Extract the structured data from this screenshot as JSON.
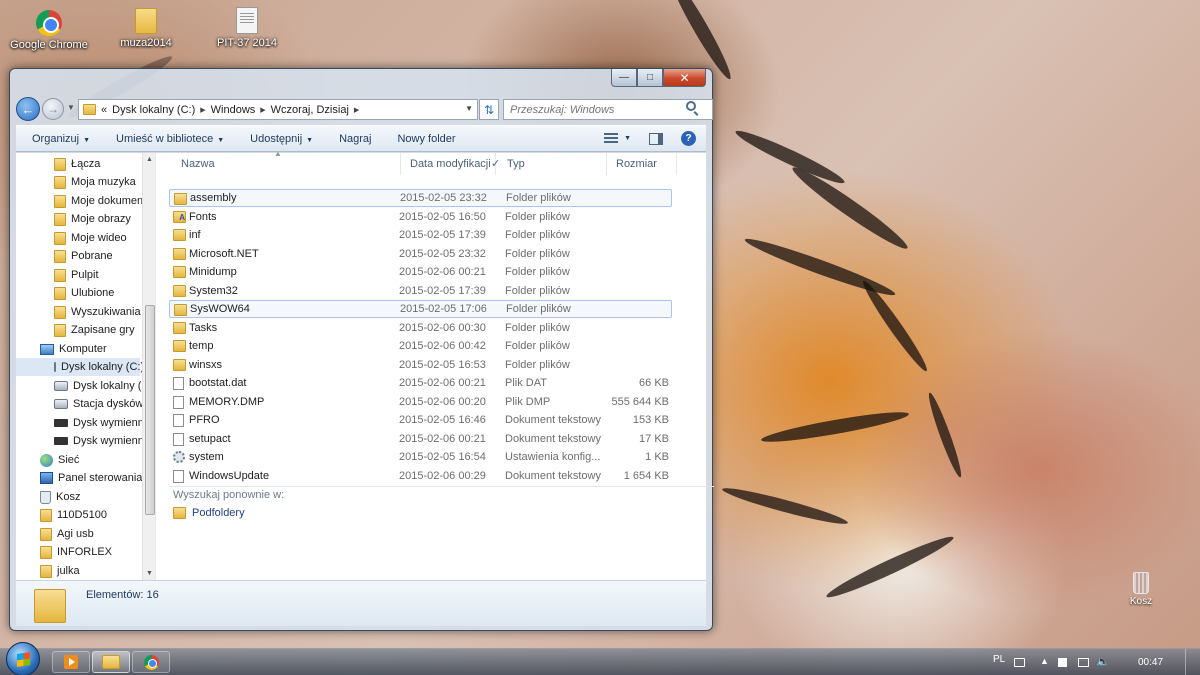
{
  "desktop": {
    "icons": [
      {
        "label": "Google Chrome",
        "icon": "chrome-icon"
      },
      {
        "label": "muza2014",
        "icon": "folder-icon"
      },
      {
        "label": "PIT-37 2014",
        "icon": "document-icon"
      }
    ],
    "recycle_bin": "Kosz"
  },
  "window": {
    "address": {
      "overflow": "«",
      "segments": [
        "Dysk lokalny (C:)",
        "Windows",
        "Wczoraj, Dzisiaj"
      ]
    },
    "search_placeholder": "Przeszukaj: Windows",
    "toolbar": {
      "organize": "Organizuj",
      "include_library": "Umieść w bibliotece",
      "share": "Udostępnij",
      "burn": "Nagraj",
      "new_folder": "Nowy folder"
    },
    "nav_pane": [
      {
        "label": "Łącza",
        "icon": "folder"
      },
      {
        "label": "Moja muzyka",
        "icon": "folder"
      },
      {
        "label": "Moje dokumenty",
        "icon": "folder"
      },
      {
        "label": "Moje obrazy",
        "icon": "folder"
      },
      {
        "label": "Moje wideo",
        "icon": "folder"
      },
      {
        "label": "Pobrane",
        "icon": "folder"
      },
      {
        "label": "Pulpit",
        "icon": "folder"
      },
      {
        "label": "Ulubione",
        "icon": "folder"
      },
      {
        "label": "Wyszukiwania",
        "icon": "folder"
      },
      {
        "label": "Zapisane gry",
        "icon": "folder"
      },
      {
        "label": "Komputer",
        "icon": "computer"
      },
      {
        "label": "Dysk lokalny (C:)",
        "icon": "drive"
      },
      {
        "label": "Dysk lokalny (D:)",
        "icon": "drive"
      },
      {
        "label": "Stacja dysków DVD",
        "icon": "drive"
      },
      {
        "label": "Dysk wymienny",
        "icon": "removable"
      },
      {
        "label": "Dysk wymienny",
        "icon": "removable"
      },
      {
        "label": "Sieć",
        "icon": "network"
      },
      {
        "label": "Panel sterowania",
        "icon": "panel"
      },
      {
        "label": "Kosz",
        "icon": "bin"
      },
      {
        "label": "110D5100",
        "icon": "folder"
      },
      {
        "label": "Agi usb",
        "icon": "folder"
      },
      {
        "label": "INFORLEX",
        "icon": "folder"
      },
      {
        "label": "julka",
        "icon": "folder"
      }
    ],
    "columns": {
      "name": "Nazwa",
      "date": "Data modyfikacji",
      "type": "Typ",
      "size": "Rozmiar"
    },
    "files": [
      {
        "name": "assembly",
        "date": "2015-02-05 23:32",
        "type": "Folder plików",
        "size": "",
        "icon": "folder"
      },
      {
        "name": "Fonts",
        "date": "2015-02-05 16:50",
        "type": "Folder plików",
        "size": "",
        "icon": "font"
      },
      {
        "name": "inf",
        "date": "2015-02-05 17:39",
        "type": "Folder plików",
        "size": "",
        "icon": "folder"
      },
      {
        "name": "Microsoft.NET",
        "date": "2015-02-05 23:32",
        "type": "Folder plików",
        "size": "",
        "icon": "folder"
      },
      {
        "name": "Minidump",
        "date": "2015-02-06 00:21",
        "type": "Folder plików",
        "size": "",
        "icon": "folder"
      },
      {
        "name": "System32",
        "date": "2015-02-05 17:39",
        "type": "Folder plików",
        "size": "",
        "icon": "folder"
      },
      {
        "name": "SysWOW64",
        "date": "2015-02-05 17:06",
        "type": "Folder plików",
        "size": "",
        "icon": "folder"
      },
      {
        "name": "Tasks",
        "date": "2015-02-06 00:30",
        "type": "Folder plików",
        "size": "",
        "icon": "folder"
      },
      {
        "name": "temp",
        "date": "2015-02-06 00:42",
        "type": "Folder plików",
        "size": "",
        "icon": "folder"
      },
      {
        "name": "winsxs",
        "date": "2015-02-05 16:53",
        "type": "Folder plików",
        "size": "",
        "icon": "folder"
      },
      {
        "name": "bootstat.dat",
        "date": "2015-02-06 00:21",
        "type": "Plik DAT",
        "size": "66 KB",
        "icon": "file"
      },
      {
        "name": "MEMORY.DMP",
        "date": "2015-02-06 00:20",
        "type": "Plik DMP",
        "size": "555 644 KB",
        "icon": "file"
      },
      {
        "name": "PFRO",
        "date": "2015-02-05 16:46",
        "type": "Dokument tekstowy",
        "size": "153 KB",
        "icon": "file"
      },
      {
        "name": "setupact",
        "date": "2015-02-06 00:21",
        "type": "Dokument tekstowy",
        "size": "17 KB",
        "icon": "file"
      },
      {
        "name": "system",
        "date": "2015-02-05 16:54",
        "type": "Ustawienia konfig...",
        "size": "1 KB",
        "icon": "settings"
      },
      {
        "name": "WindowsUpdate",
        "date": "2015-02-06 00:29",
        "type": "Dokument tekstowy",
        "size": "1 654 KB",
        "icon": "file"
      }
    ],
    "search_again_label": "Wyszukaj ponownie w:",
    "subfolders_label": "Podfoldery",
    "details_count": "Elementów: 16"
  },
  "taskbar": {
    "language": "PL",
    "clock": "00:47"
  }
}
